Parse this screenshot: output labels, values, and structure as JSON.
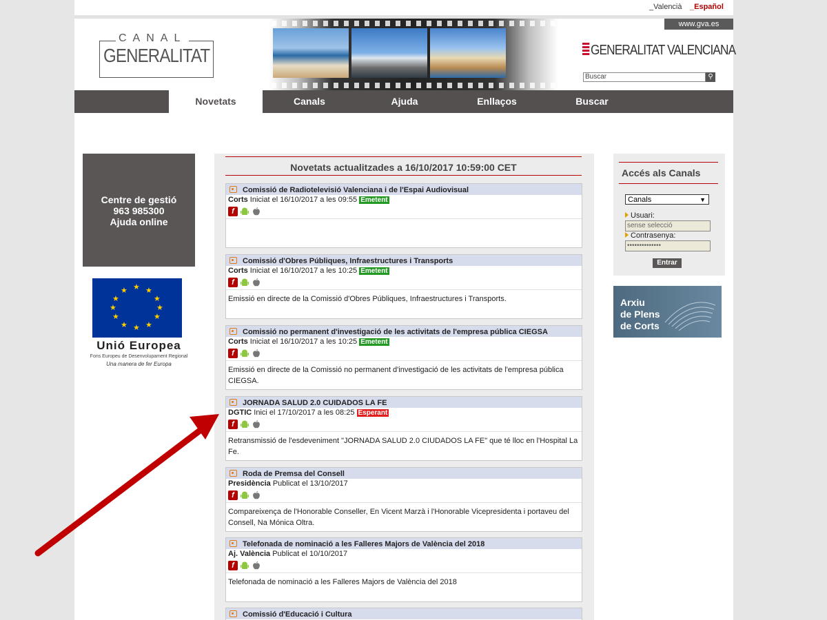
{
  "lang": {
    "valencia": "_Valencià",
    "espanol": "_Español"
  },
  "header": {
    "canal": "CANAL",
    "generalitat": "GENERALITAT",
    "gva": "www.gva.es",
    "gv_logo": "GENERALITAT VALENCIANA",
    "search_placeholder": "Buscar"
  },
  "nav": [
    "Novetats",
    "Canals",
    "Ajuda",
    "Enllaços",
    "Buscar"
  ],
  "left": {
    "line1": "Centre de gestió",
    "line2": "963 985300",
    "line3": "Ajuda online",
    "eu_title": "Unió Europea",
    "eu_sub": "Fons Europeu de Desenvolupament Regional",
    "eu_sub2": "Una manera de fer Europa"
  },
  "main": {
    "title": "Novetats actualitzades a 16/10/2017 10:59:00 CET",
    "items": [
      {
        "title": "Comissió de Radiotelevisió Valenciana i de l'Espai Audiovisual",
        "source": "Corts",
        "meta": " Iniciat el 16/10/2017 a les 09:55 ",
        "status": "Emetent",
        "desc": ""
      },
      {
        "title": "Comissió d'Obres Públiques, Infraestructures i Transports",
        "source": "Corts",
        "meta": " Iniciat el 16/10/2017 a les 10:25 ",
        "status": "Emetent",
        "desc": "Emissió en directe de la Comissió d'Obres Públiques, Infraestructures i Transports."
      },
      {
        "title": "Comissió no permanent d'investigació de les activitats de l'empresa pública CIEGSA",
        "source": "Corts",
        "meta": " Iniciat el 16/10/2017 a les 10:25 ",
        "status": "Emetent",
        "desc": "Emissió en directe de la Comissió no permanent d'investigació de les activitats de l'empresa pública CIEGSA."
      },
      {
        "title": "JORNADA SALUD 2.0 CUIDADOS LA FE",
        "source": "DGTIC",
        "meta": " Inici el 17/10/2017 a les 08:25 ",
        "status": "Esperant",
        "desc": "Retransmissió de l'esdeveniment \"JORNADA SALUD 2.0 CIUDADOS LA FE\" que té lloc en l'Hospital La Fe."
      },
      {
        "title": "Roda de Premsa del Consell",
        "source": "Presidència",
        "meta": " Publicat el 13/10/2017",
        "status": "",
        "desc": "Compareixença de l'Honorable Conseller, En Vicent Marzà i l'Honorable Vicepresidenta i portaveu del Consell, Na Mónica Oltra."
      },
      {
        "title": "Telefonada de nominació a les Falleres Majors de València del 2018",
        "source": "Aj. València",
        "meta": " Publicat el 10/10/2017",
        "status": "",
        "desc": "Telefonada de nominació a les Falleres Majors de València del 2018"
      },
      {
        "title": "Comissió d'Educació i Cultura",
        "source": "",
        "meta": "",
        "status": "",
        "desc": ""
      }
    ]
  },
  "right": {
    "title": "Accés als Canals",
    "select": "Canals",
    "user_label": "Usuari:",
    "user_value": "sense selecció",
    "pass_label": "Contrasenya:",
    "pass_value": "••••••••••••••",
    "enter": "Entrar",
    "arxiu1": "Arxiu",
    "arxiu2": "de Plens",
    "arxiu3": "de Corts"
  },
  "colors": {
    "nav": "#545050",
    "accent": "#b40000",
    "emetent": "#229922",
    "esperant": "#e21f1f",
    "arrow": "#c00000"
  }
}
